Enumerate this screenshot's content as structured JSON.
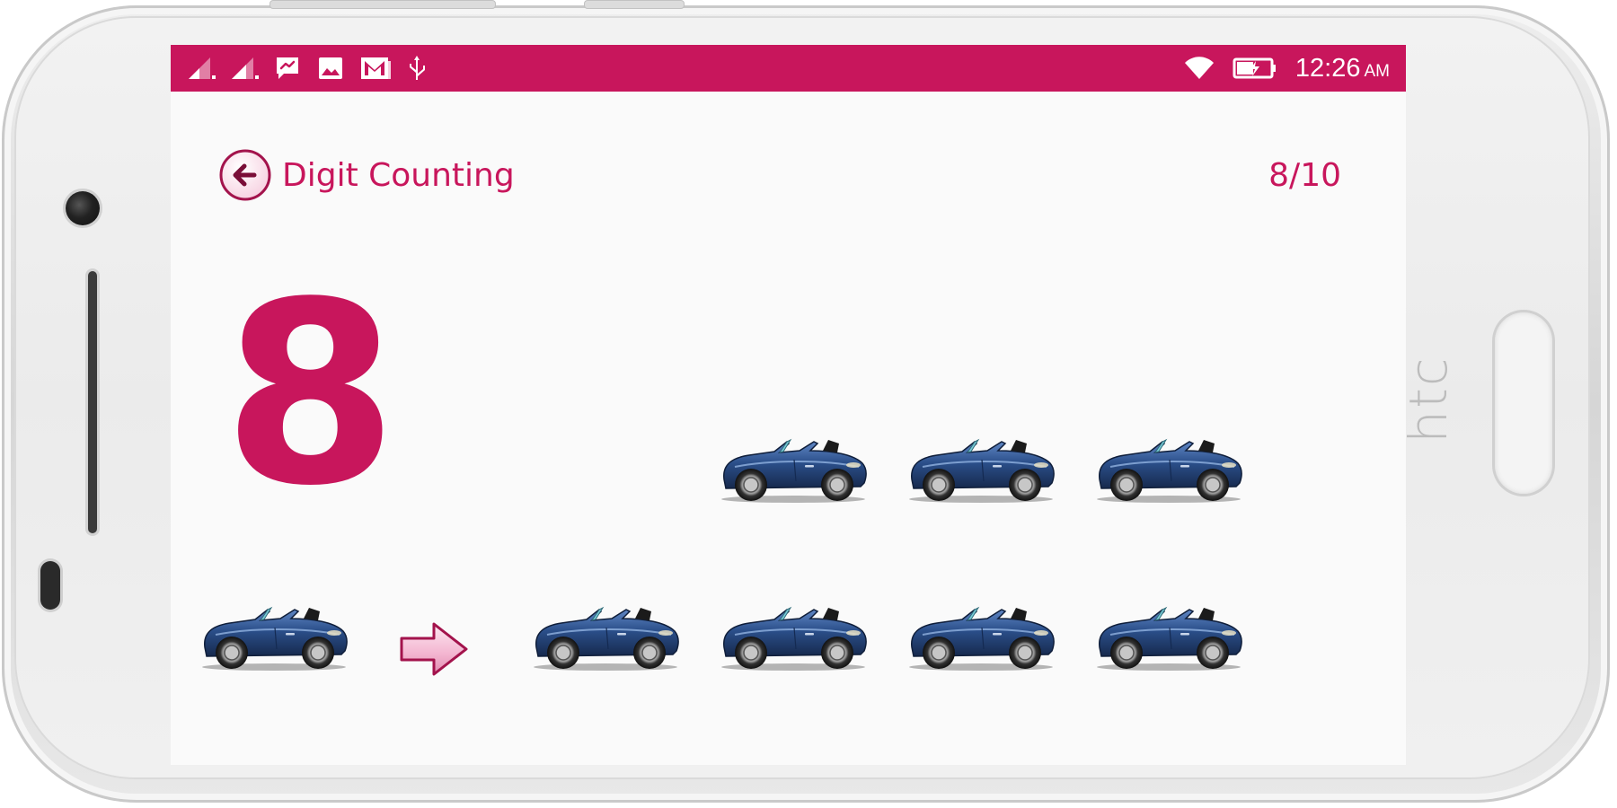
{
  "status_bar": {
    "time": "12:26",
    "ampm": "AM",
    "background_color": "#c8165c",
    "left_icons": [
      "signal-icon",
      "signal-icon",
      "messenger-icon",
      "gallery-icon",
      "gmail-icon",
      "usb-icon"
    ],
    "right_icons": [
      "wifi-icon",
      "battery-charging-icon"
    ]
  },
  "header": {
    "back_icon": "back-arrow-icon",
    "title": "Digit Counting",
    "progress": "8/10",
    "progress_value": 8,
    "progress_total": 10
  },
  "main": {
    "digit": "8",
    "example_icon": "car-icon",
    "next_icon": "next-arrow-icon",
    "counting_items": [
      "car-icon",
      "car-icon",
      "car-icon",
      "car-icon",
      "car-icon",
      "car-icon",
      "car-icon"
    ]
  },
  "device": {
    "brand": "htc"
  },
  "colors": {
    "accent": "#c8165c",
    "screen_background": "#fafafa",
    "car_body": "#2b4f8a"
  }
}
